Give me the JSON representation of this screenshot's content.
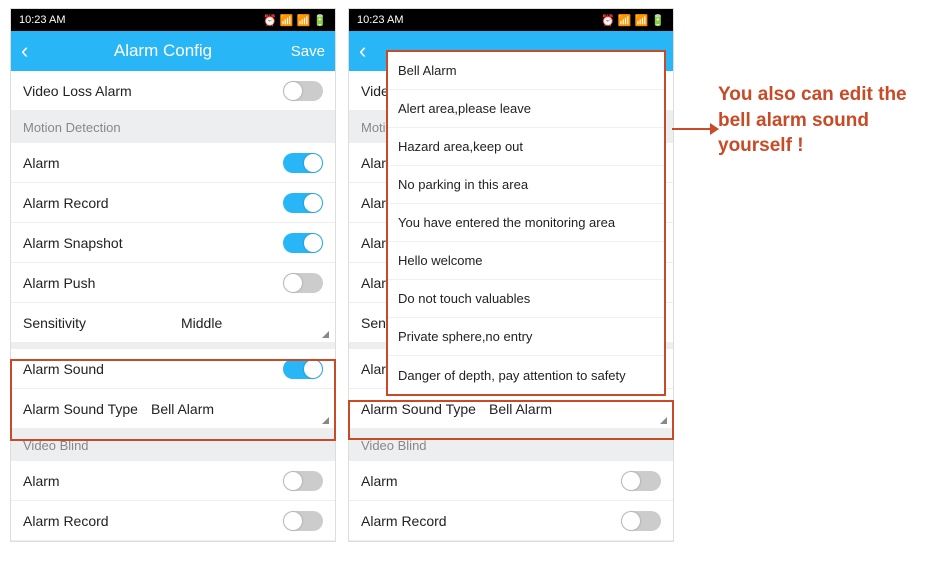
{
  "statusbar": {
    "time": "10:23  AM",
    "icons_text": "⏰ 📶 📶 🔋"
  },
  "navbar": {
    "back": "‹",
    "title": "Alarm Config",
    "save": "Save"
  },
  "screen1": {
    "rows": [
      {
        "label": "Video Loss Alarm",
        "on": false
      }
    ],
    "section_motion": "Motion Detection",
    "motion_rows": [
      {
        "label": "Alarm",
        "on": true
      },
      {
        "label": "Alarm Record",
        "on": true
      },
      {
        "label": "Alarm Snapshot",
        "on": true
      },
      {
        "label": "Alarm Push",
        "on": false
      }
    ],
    "sensitivity": {
      "label": "Sensitivity",
      "value": "Middle"
    },
    "sound_row": {
      "label": "Alarm Sound",
      "on": true
    },
    "sound_type": {
      "label": "Alarm Sound Type",
      "value": "Bell Alarm"
    },
    "section_blind": "Video Blind",
    "blind_rows": [
      {
        "label": "Alarm",
        "on": false
      },
      {
        "label": "Alarm Record",
        "on": false
      }
    ]
  },
  "screen2": {
    "rows_trunc": [
      {
        "label": "Video"
      },
      {
        "label": "Motio",
        "section": true
      },
      {
        "label": "Alarm"
      },
      {
        "label": "Alarm"
      },
      {
        "label": "Alarm"
      },
      {
        "label": "Alarm"
      },
      {
        "label": "Sensit"
      },
      {
        "label": "Alarm"
      }
    ],
    "sound_type": {
      "label": "Alarm Sound Type",
      "value": "Bell Alarm"
    },
    "section_blind": "Video Blind",
    "blind_rows": [
      {
        "label": "Alarm",
        "on": false
      },
      {
        "label": "Alarm Record",
        "on": false
      }
    ]
  },
  "dropdown_options": [
    "Bell Alarm",
    "Alert area,please leave",
    "Hazard area,keep out",
    "No parking in this area",
    "You have entered the monitoring area",
    "Hello welcome",
    "Do not touch valuables",
    "Private sphere,no entry",
    "Danger of depth, pay attention to safety"
  ],
  "annotation": "You also can edit the bell alarm sound yourself !"
}
